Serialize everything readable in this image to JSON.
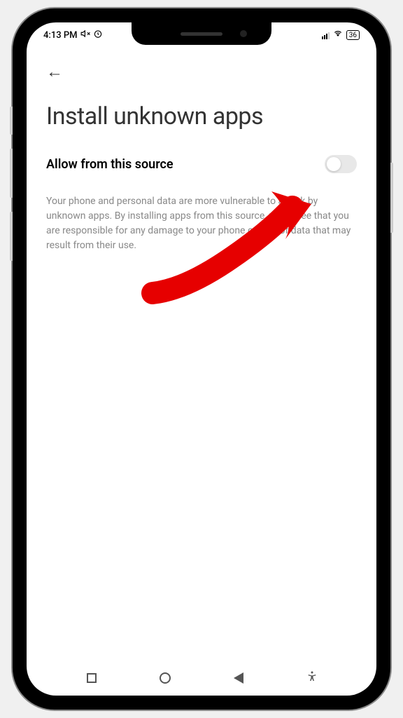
{
  "status_bar": {
    "time": "4:13 PM",
    "battery_percent": "36"
  },
  "header": {
    "back_icon": "←"
  },
  "page": {
    "title": "Install unknown apps"
  },
  "setting": {
    "label": "Allow from this source",
    "enabled": false
  },
  "description": {
    "text": "Your phone and personal data are more vulnerable to attack by unknown apps. By installing apps from this source, you agree that you are responsible for any damage to your phone or loss of data that may result from their use."
  },
  "annotation": {
    "color": "#e60000"
  }
}
